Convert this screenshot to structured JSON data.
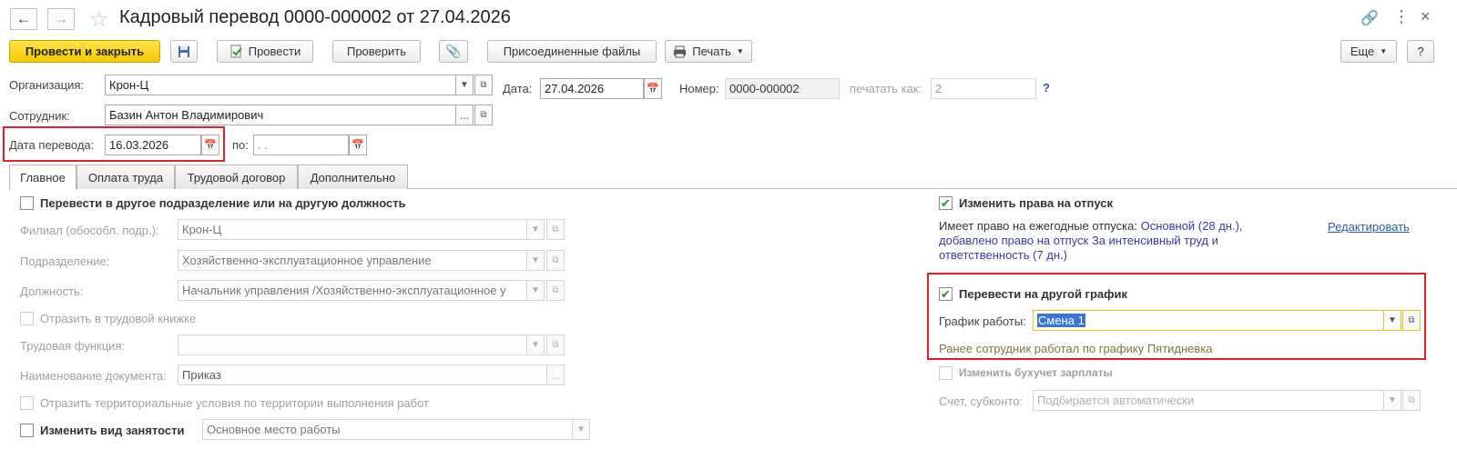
{
  "window": {
    "title": "Кадровый перевод 0000-000002 от 27.04.2026",
    "more_icon": "⋮",
    "close_icon": "×"
  },
  "toolbar": {
    "post_close_label": "Провести и закрыть",
    "post_label": "Провести",
    "check_label": "Проверить",
    "files_label": "Присоединенные файлы",
    "print_label": "Печать",
    "more_label": "Еще",
    "help_label": "?"
  },
  "header": {
    "org_label": "Организация:",
    "org_value": "Крон-Ц",
    "date_label": "Дата:",
    "date_value": "27.04.2026",
    "number_label": "Номер:",
    "number_value": "0000-000002",
    "print_as_label": "печатать как:",
    "print_as_value": "2",
    "help_q": "?",
    "employee_label": "Сотрудник:",
    "employee_value": "Базин Антон Владимирович",
    "transfer_date_label": "Дата перевода:",
    "transfer_date_value": "16.03.2026",
    "to_label": "по:",
    "to_value": " .  ."
  },
  "tabs": [
    {
      "label": "Главное"
    },
    {
      "label": "Оплата труда"
    },
    {
      "label": "Трудовой договор"
    },
    {
      "label": "Дополнительно"
    }
  ],
  "left": {
    "transfer_dept_label": "Перевести в другое подразделение или на другую должность",
    "branch_label": "Филиал (обособл. подр.):",
    "branch_value": "Крон-Ц",
    "dept_label": "Подразделение:",
    "dept_value": "Хозяйственно-эксплуатационное управление",
    "position_label": "Должность:",
    "position_value": "Начальник управления /Хозяйственно-эксплуатационное у",
    "workbook_label": "Отразить в трудовой книжке",
    "labor_func_label": "Трудовая функция:",
    "labor_func_value": "",
    "doc_name_label": "Наименование документа:",
    "doc_name_value": "Приказ",
    "territorial_label": "Отразить территориальные условия по территории выполнения работ",
    "employment_label": "Изменить вид занятости",
    "employment_value": "Основное место работы",
    "ellipsis": "..."
  },
  "right": {
    "vacation_label": "Изменить права на отпуск",
    "vacation_text_prefix": "Имеет право на ежегодные отпуска: ",
    "vacation_text_main": "Основной (28 дн.),",
    "vacation_text_line2": "добавлено право на отпуск За интенсивный труд и",
    "vacation_text_line3": "ответственность (7 дн.)",
    "edit_link": "Редактировать",
    "schedule_check_label": "Перевести на другой график",
    "schedule_label": "График работы:",
    "schedule_value": "Смена 1",
    "schedule_prev": "Ранее сотрудник работал по графику Пятидневка",
    "accounting_label": "Изменить бухучет зарплаты",
    "account_label": "Счет, субконто:",
    "account_placeholder": "Подбирается автоматически"
  },
  "colors": {
    "primary_button": "#f6c800",
    "highlight_border": "#e0202a",
    "link": "#2a5aa8"
  }
}
